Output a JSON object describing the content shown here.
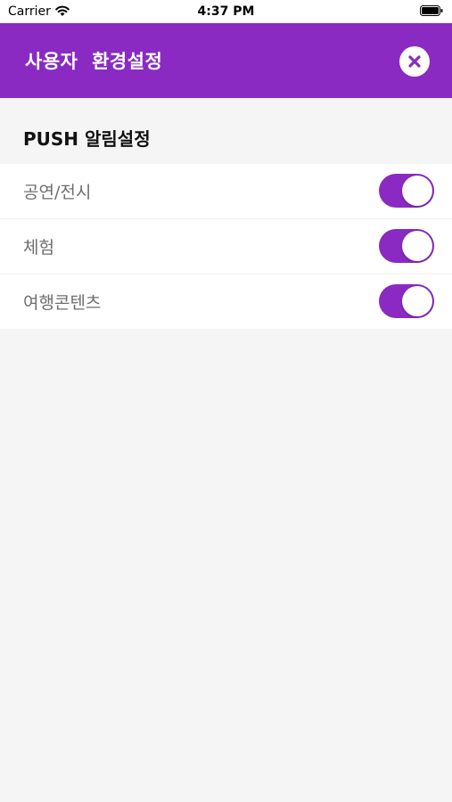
{
  "status_bar": {
    "carrier": "Carrier",
    "time": "4:37 PM",
    "wifi_icon": "wifi-icon",
    "battery_icon": "battery-icon"
  },
  "header": {
    "title": "사용자  환경설정",
    "close_icon": "close-icon",
    "background_color": "#8a2ac3"
  },
  "section": {
    "title": "PUSH 알림설정"
  },
  "settings": [
    {
      "label": "공연/전시",
      "enabled": true
    },
    {
      "label": "체험",
      "enabled": true
    },
    {
      "label": "여행콘텐츠",
      "enabled": true
    }
  ],
  "colors": {
    "accent": "#8a2ac3",
    "background": "#f5f5f5",
    "label_text": "#6e6e6e"
  }
}
